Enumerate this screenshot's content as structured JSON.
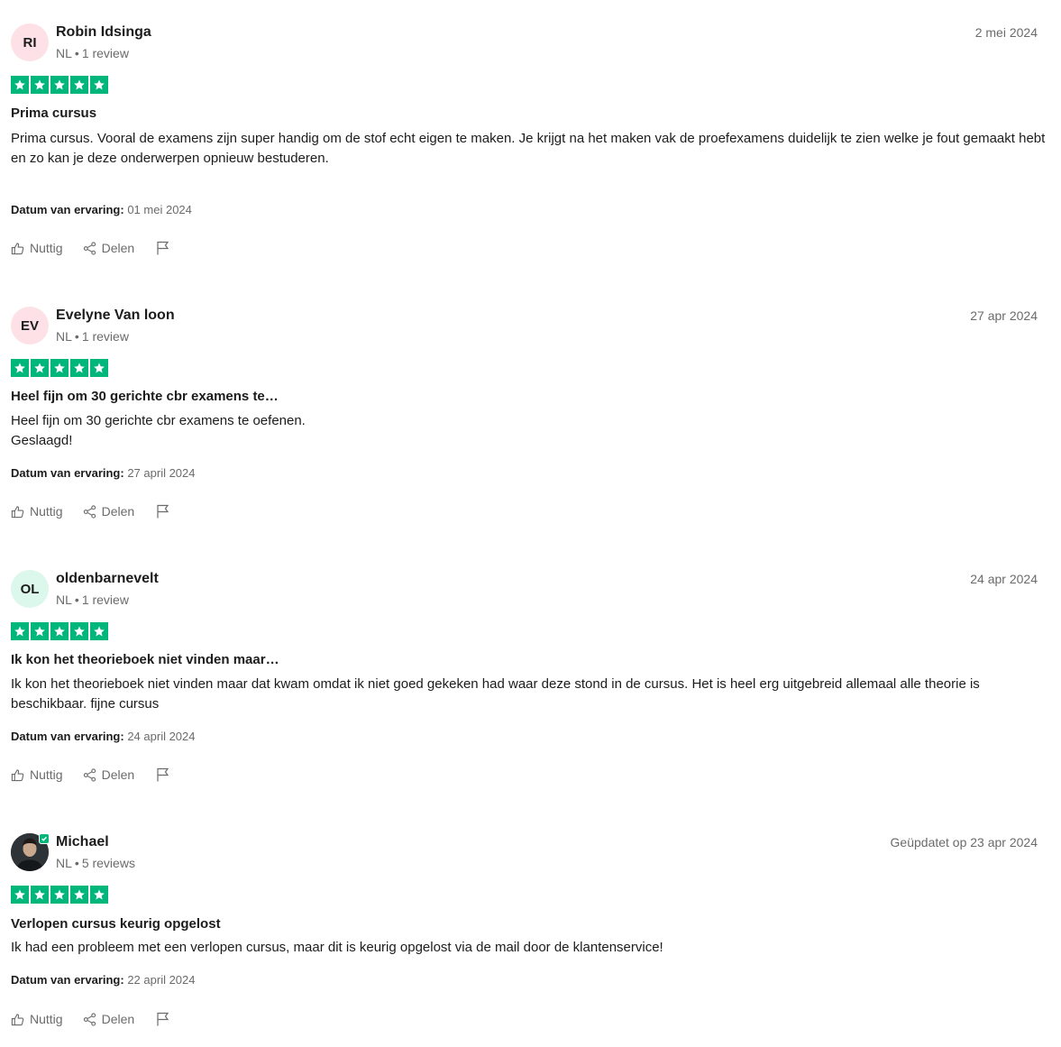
{
  "labels": {
    "experience_label": "Datum van ervaring:",
    "helpful": "Nuttig",
    "share": "Delen",
    "dot": "•"
  },
  "colors": {
    "star_green": "#00b67a",
    "avatar_pink": "#fde1e7",
    "avatar_mint": "#dcf7ec"
  },
  "reviews": [
    {
      "initials": "RI",
      "name": "Robin Idsinga",
      "country": "NL",
      "review_count": "1 review",
      "date": "2 mei 2024",
      "rating": 5,
      "title": "Prima cursus",
      "body": [
        "Prima cursus. Vooral de examens zijn super handig om de stof echt eigen te maken. Je krijgt na het maken vak de proefexamens duidelijk te zien welke je fout gemaakt hebt en zo kan je deze onderwerpen opnieuw bestuderen."
      ],
      "experience_date": "01 mei 2024"
    },
    {
      "initials": "EV",
      "name": "Evelyne Van loon",
      "country": "NL",
      "review_count": "1 review",
      "date": "27 apr 2024",
      "rating": 5,
      "title": "Heel fijn om 30 gerichte cbr examens te…",
      "body": [
        "Heel fijn om 30 gerichte cbr examens te oefenen.",
        "Geslaagd!"
      ],
      "experience_date": "27 april 2024"
    },
    {
      "initials": "OL",
      "name": "oldenbarnevelt",
      "country": "NL",
      "review_count": "1 review",
      "date": "24 apr 2024",
      "rating": 5,
      "title": "Ik kon het theorieboek niet vinden maar…",
      "body": [
        "Ik kon het theorieboek niet vinden maar dat kwam omdat ik niet goed gekeken had waar deze stond in de cursus. Het is heel erg uitgebreid allemaal alle theorie is beschikbaar. fijne cursus"
      ],
      "experience_date": "24 april 2024"
    },
    {
      "initials": "",
      "name": "Michael",
      "country": "NL",
      "review_count": "5 reviews",
      "date": "Geüpdatet op 23 apr 2024",
      "rating": 5,
      "title": "Verlopen cursus keurig opgelost",
      "body": [
        "Ik had een probleem met een verlopen cursus, maar dit is keurig opgelost via de mail door de klantenservice!"
      ],
      "experience_date": "22 april 2024",
      "verified": true
    }
  ]
}
